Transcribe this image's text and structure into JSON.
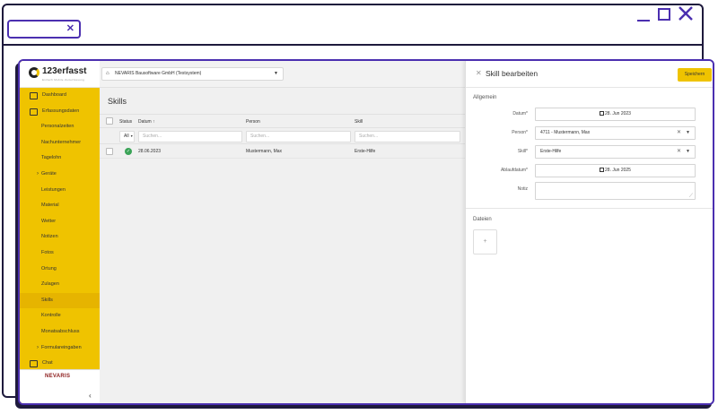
{
  "app": {
    "logo_text": "123erfasst",
    "logo_sub": "Einfach Mobile Zeiterfassung",
    "company": "NEVARIS Bausoftware GmbH (Testsystem)",
    "brand_footer": "NEVARIS"
  },
  "sidebar": {
    "items": [
      {
        "label": "Dashboard",
        "type": "top",
        "icon": "dashboard-icon"
      },
      {
        "label": "Erfassungsdaten",
        "type": "top",
        "icon": "records-icon"
      },
      {
        "label": "Personalzeiten",
        "type": "sub"
      },
      {
        "label": "Nachunternehmer",
        "type": "sub"
      },
      {
        "label": "Tagelohn",
        "type": "sub"
      },
      {
        "label": "Geräte",
        "type": "sub",
        "chevron": true
      },
      {
        "label": "Leistungen",
        "type": "sub"
      },
      {
        "label": "Material",
        "type": "sub"
      },
      {
        "label": "Wetter",
        "type": "sub"
      },
      {
        "label": "Notizen",
        "type": "sub"
      },
      {
        "label": "Fotos",
        "type": "sub"
      },
      {
        "label": "Ortung",
        "type": "sub"
      },
      {
        "label": "Zulagen",
        "type": "sub"
      },
      {
        "label": "Skills",
        "type": "sub",
        "active": true
      },
      {
        "label": "Kontrolle",
        "type": "sub"
      },
      {
        "label": "Monatsabschluss",
        "type": "sub"
      },
      {
        "label": "Formulareingaben",
        "type": "sub",
        "chevron": true
      },
      {
        "label": "Chat",
        "type": "top",
        "icon": "chat-icon"
      }
    ],
    "collapse_glyph": "‹"
  },
  "main": {
    "title": "Skills",
    "columns": {
      "status": "Status",
      "datum": "Datum",
      "person": "Person",
      "skill": "Skill"
    },
    "filter": {
      "status_value": "All",
      "datum_placeholder": "Suchen...",
      "person_placeholder": "Suchen...",
      "skill_placeholder": "Suchen..."
    },
    "rows": [
      {
        "datum": "28.06.2023",
        "person": "Mustermann, Max",
        "skill": "Erste-Hilfe",
        "status": "ok"
      }
    ]
  },
  "panel": {
    "title": "Skill bearbeiten",
    "save_label": "Speichern",
    "section_general": "Allgemein",
    "datum_label": "Datum*",
    "datum_value": "28. Jun 2023",
    "person_label": "Person*",
    "person_value": "4711 - Mustermann, Max",
    "skill_label": "Skill*",
    "skill_value": "Erste-Hilfe",
    "expiry_label": "Ablaufdatum*",
    "expiry_value": "28. Jun 2025",
    "note_label": "Notiz",
    "section_files": "Dateien",
    "upload_glyph": "+"
  },
  "colors": {
    "accent": "#efc300",
    "frame": "#4b2fb0",
    "success": "#3aa357"
  }
}
